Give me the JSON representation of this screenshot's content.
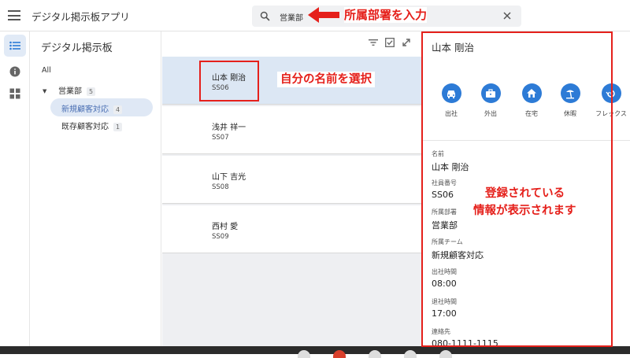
{
  "app": {
    "title": "デジタル掲示板アプリ"
  },
  "search": {
    "value": "営業部"
  },
  "tree": {
    "header": "デジタル掲示板",
    "all_label": "All",
    "department": {
      "label": "営業部",
      "count": "5"
    },
    "teams": [
      {
        "label": "新規顧客対応",
        "count": "4"
      },
      {
        "label": "既存顧客対応",
        "count": "1"
      }
    ]
  },
  "members": [
    {
      "name": "山本 剛治",
      "id": "SS06"
    },
    {
      "name": "浅井 祥一",
      "id": "SS07"
    },
    {
      "name": "山下 吉光",
      "id": "SS08"
    },
    {
      "name": "西村 愛",
      "id": "SS09"
    }
  ],
  "detail": {
    "title": "山本 剛治",
    "actions": [
      "出社",
      "外出",
      "在宅",
      "休暇",
      "フレックス"
    ],
    "fields": [
      {
        "label": "名前",
        "value": "山本 剛治"
      },
      {
        "label": "社員番号",
        "value": "SS06"
      },
      {
        "label": "所属部署",
        "value": "営業部"
      },
      {
        "label": "所属チーム",
        "value": "新規顧客対応"
      },
      {
        "label": "出社時間",
        "value": "08:00"
      },
      {
        "label": "退社時間",
        "value": "17:00"
      },
      {
        "label": "連絡先",
        "value": "080-1111-1115"
      }
    ]
  },
  "annotations": {
    "search_hint": "所属部署を入力",
    "select_hint": "自分の名前を選択",
    "info_line1": "登録されている",
    "info_line2": "情報が表示されます"
  },
  "colors": {
    "accent": "#2d7bd6",
    "annotation": "#e5201b",
    "selected_row": "#dce7f4"
  }
}
